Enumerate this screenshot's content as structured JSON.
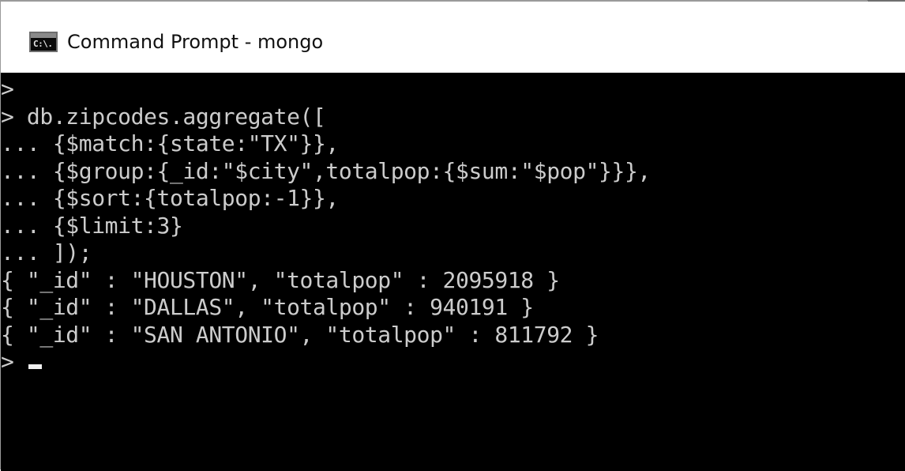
{
  "window": {
    "title": "Command Prompt - mongo",
    "icon": "console-app-icon",
    "icon_glyph": "C:\\."
  },
  "console": {
    "lines": [
      ">",
      "> db.zipcodes.aggregate([",
      "... {$match:{state:\"TX\"}},",
      "... {$group:{_id:\"$city\",totalpop:{$sum:\"$pop\"}}},",
      "... {$sort:{totalpop:-1}},",
      "... {$limit:3}",
      "... ]);",
      "{ \"_id\" : \"HOUSTON\", \"totalpop\" : 2095918 }",
      "{ \"_id\" : \"DALLAS\", \"totalpop\" : 940191 }",
      "{ \"_id\" : \"SAN ANTONIO\", \"totalpop\" : 811792 }"
    ],
    "prompt": "> "
  },
  "colors": {
    "console_bg": "#000000",
    "console_text": "#cccccc",
    "titlebar_bg": "#ffffff",
    "cursor": "#f0f0f0"
  }
}
